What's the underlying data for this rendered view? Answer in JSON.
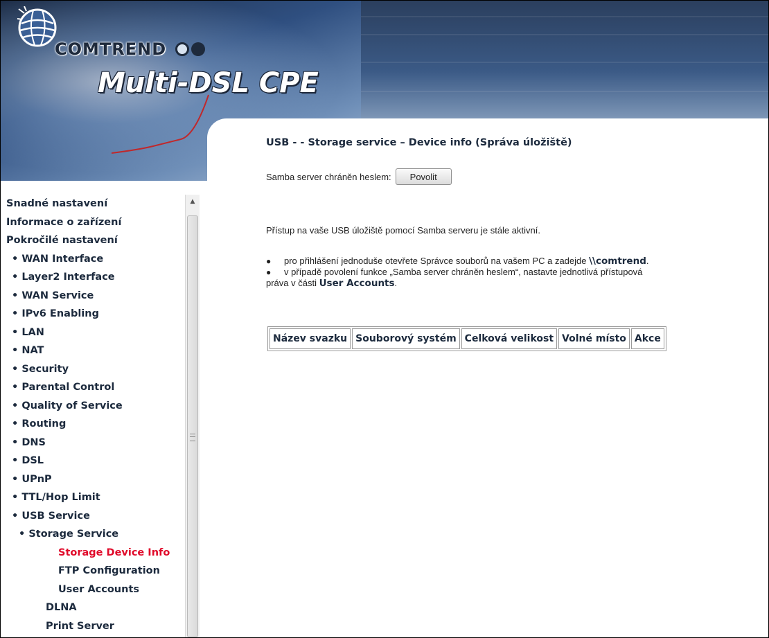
{
  "header": {
    "brand": "COMTREND",
    "product": "Multi-DSL CPE"
  },
  "sidebar": {
    "items": [
      {
        "label": "Snadné nastavení",
        "level": 1
      },
      {
        "label": "Informace o zařízení",
        "level": 1
      },
      {
        "label": "Pokročilé nastavení",
        "level": 1
      },
      {
        "label": "• WAN Interface",
        "level": 2
      },
      {
        "label": "• Layer2 Interface",
        "level": 2
      },
      {
        "label": "• WAN Service",
        "level": 2
      },
      {
        "label": "• IPv6 Enabling",
        "level": 2
      },
      {
        "label": "• LAN",
        "level": 2
      },
      {
        "label": "• NAT",
        "level": 2
      },
      {
        "label": "• Security",
        "level": 2
      },
      {
        "label": "• Parental Control",
        "level": 2
      },
      {
        "label": "• Quality of Service",
        "level": 2
      },
      {
        "label": "• Routing",
        "level": 2
      },
      {
        "label": "• DNS",
        "level": 2
      },
      {
        "label": "• DSL",
        "level": 2
      },
      {
        "label": "• UPnP",
        "level": 2
      },
      {
        "label": "• TTL/Hop Limit",
        "level": 2
      },
      {
        "label": "• USB Service",
        "level": 2
      },
      {
        "label": "• Storage Service",
        "level": 3
      },
      {
        "label": "Storage Device Info",
        "level": 4,
        "active": true
      },
      {
        "label": "FTP Configuration",
        "level": 4
      },
      {
        "label": "User Accounts",
        "level": 4
      },
      {
        "label": "DLNA",
        "level": 5
      },
      {
        "label": "Print Server",
        "level": 5
      }
    ]
  },
  "main": {
    "title": "USB - - Storage service – Device info (Správa úložiště)",
    "samba_label": "Samba server chráněn heslem:",
    "samba_button": "Povolit",
    "access_text": "Přístup na vaše USB úložiště pomocí Samba serveru je stále aktivní.",
    "bullet1_text": "pro přihlášení jednoduše otevřete Správce souborů na vašem PC a zadejde ",
    "bullet1_bold": "\\\\comtrend",
    "bullet1_end": ".",
    "bullet2_text": "v případě povolení funkce „Samba server chráněn heslem“, nastavte jednotlivá přístupová",
    "bullet2_cont": "práva v části ",
    "bullet2_bold": "User Accounts",
    "bullet2_end": ".",
    "bullet_symbol": "●",
    "table_headers": [
      "Název svazku",
      "Souborový systém",
      "Celková velikost",
      "Volné místo",
      "Akce"
    ]
  }
}
